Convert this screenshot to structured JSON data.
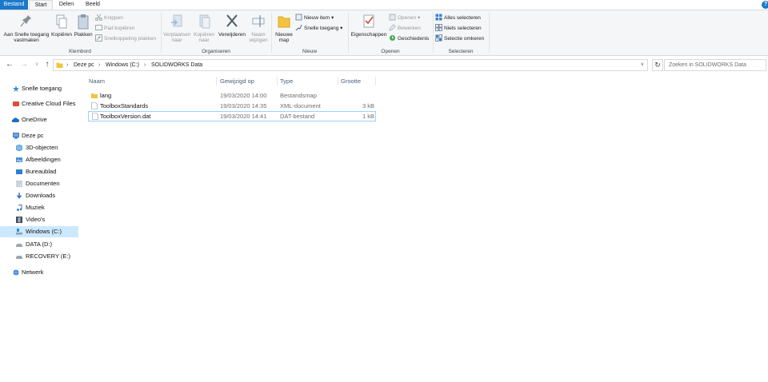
{
  "tabs": {
    "file": "Bestand",
    "start": "Start",
    "share": "Delen",
    "view": "Beeld"
  },
  "ribbon": {
    "clipboard": {
      "pin_label": "Aan Snelle toegang vastmaken",
      "copy_label": "Kopiëren",
      "paste_label": "Plakken",
      "cut_label": "Knippen",
      "copy_path_label": "Pad kopiëren",
      "paste_shortcut_label": "Snelkoppeling plakken",
      "group_label": "Klembord"
    },
    "organize": {
      "move_label": "Verplaatsen naar",
      "copy_to_label": "Kopiëren naar",
      "delete_label": "Verwijderen",
      "rename_label": "Naam wijzigen",
      "group_label": "Organiseren"
    },
    "new": {
      "new_folder_label": "Nieuwe map",
      "new_item_label": "Nieuw item",
      "easy_access_label": "Snelle toegang",
      "group_label": "Nieuw"
    },
    "open": {
      "properties_label": "Eigenschappen",
      "open_label": "Openen",
      "edit_label": "Bewerken",
      "history_label": "Geschiedenis",
      "group_label": "Openen"
    },
    "select": {
      "select_all_label": "Alles selecteren",
      "select_none_label": "Niets selecteren",
      "invert_label": "Selectie omkeren",
      "group_label": "Selecteren"
    }
  },
  "address": {
    "crumbs": [
      "Deze pc",
      "Windows (C:)",
      "SOLIDWORKS Data"
    ],
    "search_placeholder": "Zoeken in SOLIDWORKS Data"
  },
  "nav": {
    "quick_access": "Snelle toegang",
    "creative_cloud": "Creative Cloud Files",
    "onedrive": "OneDrive",
    "this_pc": "Deze pc",
    "objects3d": "3D-objecten",
    "pictures": "Afbeeldingen",
    "desktop": "Bureaublad",
    "documents": "Documenten",
    "downloads": "Downloads",
    "music": "Muziek",
    "videos": "Video's",
    "windows_c": "Windows (C:)",
    "data_d": "DATA (D:)",
    "recovery_e": "RECOVERY (E:)",
    "network": "Netwerk"
  },
  "columns": {
    "name": "Naam",
    "modified": "Gewijzigd op",
    "type": "Type",
    "size": "Grootte"
  },
  "files": [
    {
      "name": "lang",
      "modified": "19/03/2020 14:00",
      "type": "Bestandsmap",
      "size": ""
    },
    {
      "name": "ToolboxStandards",
      "modified": "19/03/2020 14:35",
      "type": "XML-document",
      "size": "3 kB"
    },
    {
      "name": "ToolboxVersion.dat",
      "modified": "19/03/2020 14:41",
      "type": "DAT-bestand",
      "size": "1 kB"
    }
  ],
  "colors": {
    "accent": "#1979ca",
    "selection": "#cce8ff",
    "folder": "#e8b923"
  }
}
